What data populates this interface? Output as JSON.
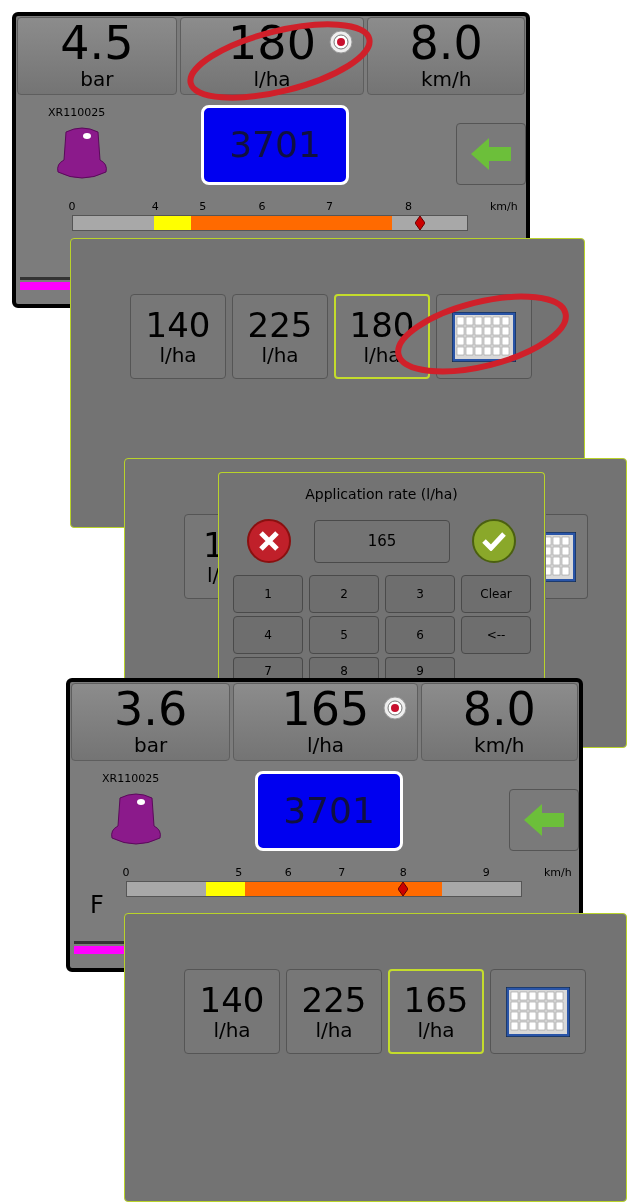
{
  "layers": [
    {
      "kind": "monitor",
      "pressure": {
        "value": "4.5",
        "unit": "bar"
      },
      "rate": {
        "value": "180",
        "unit": "l/ha"
      },
      "speed": {
        "value": "8.0",
        "unit": "km/h"
      },
      "nozzle": "XR110025",
      "section": "3701",
      "scale": {
        "ticks": [
          "0",
          "4",
          "5",
          "6",
          "7",
          "8"
        ],
        "unit": "km/h",
        "level": 0.88
      }
    },
    {
      "kind": "presets",
      "buttons": [
        {
          "value": "140",
          "unit": "l/ha",
          "selected": false
        },
        {
          "value": "225",
          "unit": "l/ha",
          "selected": false
        },
        {
          "value": "180",
          "unit": "l/ha",
          "selected": true
        }
      ]
    },
    {
      "kind": "presets_partial",
      "buttons": [
        {
          "value": "1",
          "unit": "l/",
          "selected": false
        }
      ]
    },
    {
      "kind": "keypad",
      "title": "Application rate (l/ha)",
      "value": "165",
      "keys": [
        "1",
        "2",
        "3",
        "Clear",
        "4",
        "5",
        "6",
        "<--",
        "7",
        "8",
        "9"
      ]
    },
    {
      "kind": "monitor",
      "pressure": {
        "value": "3.6",
        "unit": "bar"
      },
      "rate": {
        "value": "165",
        "unit": "l/ha"
      },
      "speed": {
        "value": "8.0",
        "unit": "km/h"
      },
      "nozzle": "XR110025",
      "section": "3701",
      "scale": {
        "label": "F",
        "ticks": [
          "0",
          "5",
          "6",
          "7",
          "8",
          "9"
        ],
        "unit": "km/h",
        "level": 0.7
      }
    },
    {
      "kind": "presets",
      "buttons": [
        {
          "value": "140",
          "unit": "l/ha",
          "selected": false
        },
        {
          "value": "225",
          "unit": "l/ha",
          "selected": false
        },
        {
          "value": "165",
          "unit": "l/ha",
          "selected": true
        }
      ]
    }
  ]
}
